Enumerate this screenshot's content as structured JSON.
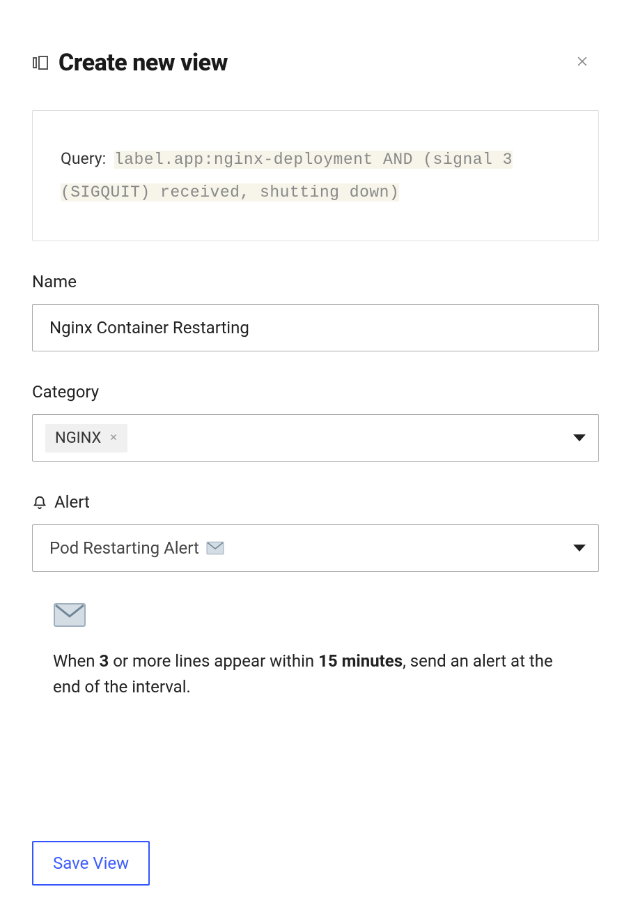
{
  "header": {
    "title": "Create new view"
  },
  "query": {
    "label": "Query:",
    "line1": "label.app:nginx-deployment AND (signal 3",
    "line2": "(SIGQUIT) received, shutting down)"
  },
  "name": {
    "label": "Name",
    "value": "Nginx Container Restarting"
  },
  "category": {
    "label": "Category",
    "tag": "NGINX"
  },
  "alert": {
    "label": "Alert",
    "value": "Pod Restarting Alert"
  },
  "desc": {
    "pre": "When ",
    "count": "3",
    "mid": " or more lines appear within ",
    "time": "15 minutes",
    "post": ", send an alert at the end of the interval."
  },
  "buttons": {
    "save": "Save View"
  }
}
